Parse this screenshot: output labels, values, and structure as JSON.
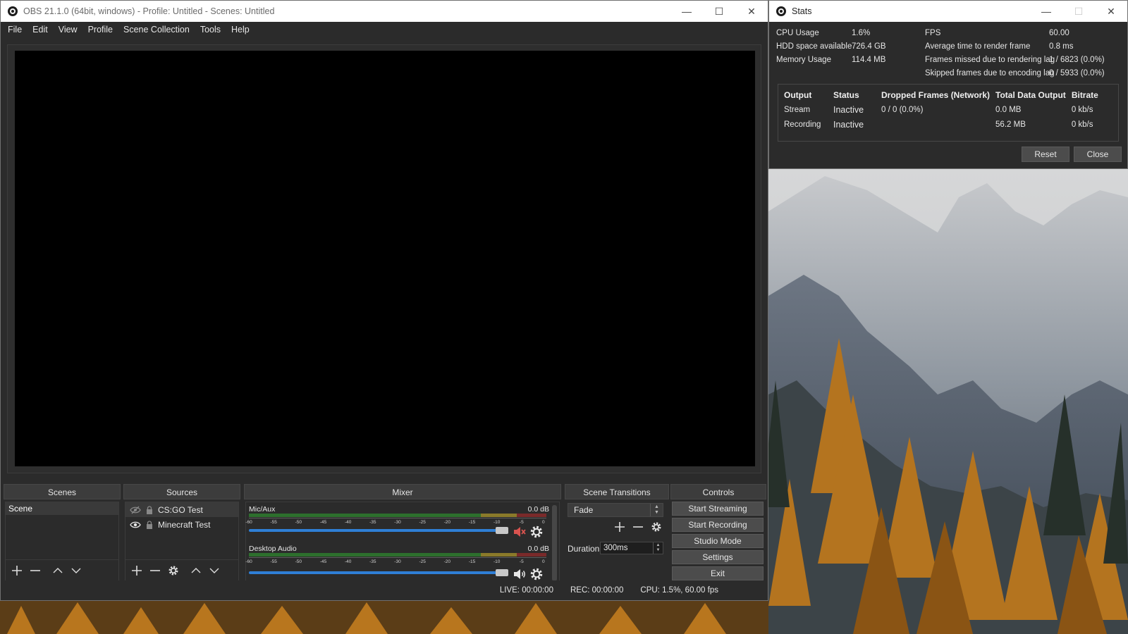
{
  "obs": {
    "title": "OBS 21.1.0 (64bit, windows) - Profile: Untitled - Scenes: Untitled",
    "menu": [
      "File",
      "Edit",
      "View",
      "Profile",
      "Scene Collection",
      "Tools",
      "Help"
    ],
    "docks": {
      "scenes": {
        "header": "Scenes",
        "items": [
          "Scene"
        ]
      },
      "sources": {
        "header": "Sources",
        "items": [
          {
            "label": "CS:GO Test",
            "visible": false,
            "locked": true
          },
          {
            "label": "Minecraft Test",
            "visible": true,
            "locked": true
          }
        ]
      },
      "mixer": {
        "header": "Mixer",
        "channels": [
          {
            "name": "Mic/Aux",
            "db": "0.0 dB",
            "muted": true,
            "volume": 1.0
          },
          {
            "name": "Desktop Audio",
            "db": "0.0 dB",
            "muted": false,
            "volume": 1.0
          }
        ],
        "ticks": [
          "-60",
          "-55",
          "-50",
          "-45",
          "-40",
          "-35",
          "-30",
          "-25",
          "-20",
          "-15",
          "-10",
          "-5",
          "0"
        ]
      },
      "transitions": {
        "header": "Scene Transitions",
        "selected": "Fade",
        "duration_label": "Duration",
        "duration_value": "300ms"
      },
      "controls": {
        "header": "Controls",
        "buttons": [
          "Start Streaming",
          "Start Recording",
          "Studio Mode",
          "Settings",
          "Exit"
        ]
      }
    },
    "status": {
      "live": "LIVE: 00:00:00",
      "rec": "REC: 00:00:00",
      "cpu": "CPU: 1.5%, 60.00 fps"
    }
  },
  "stats": {
    "title": "Stats",
    "left": [
      {
        "label": "CPU Usage",
        "value": "1.6%"
      },
      {
        "label": "HDD space available",
        "value": "726.4 GB"
      },
      {
        "label": "Memory Usage",
        "value": "114.4 MB"
      }
    ],
    "right": [
      {
        "label": "FPS",
        "value": "60.00"
      },
      {
        "label": "Average time to render frame",
        "value": "0.8 ms"
      },
      {
        "label": "Frames missed due to rendering lag",
        "value": "1 / 6823 (0.0%)"
      },
      {
        "label": "Skipped frames due to encoding lag",
        "value": "0 / 5933 (0.0%)"
      }
    ],
    "table": {
      "headers": [
        "Output",
        "Status",
        "Dropped Frames (Network)",
        "Total Data Output",
        "Bitrate"
      ],
      "rows": [
        [
          "Stream",
          "Inactive",
          "0 / 0 (0.0%)",
          "0.0 MB",
          "0 kb/s"
        ],
        [
          "Recording",
          "Inactive",
          "",
          "56.2 MB",
          "0 kb/s"
        ]
      ]
    },
    "reset_label": "Reset",
    "close_label": "Close"
  },
  "colors": {
    "accent": "#2f7fd6",
    "mute_red": "#d9534f",
    "panel": "#2b2b2b"
  }
}
